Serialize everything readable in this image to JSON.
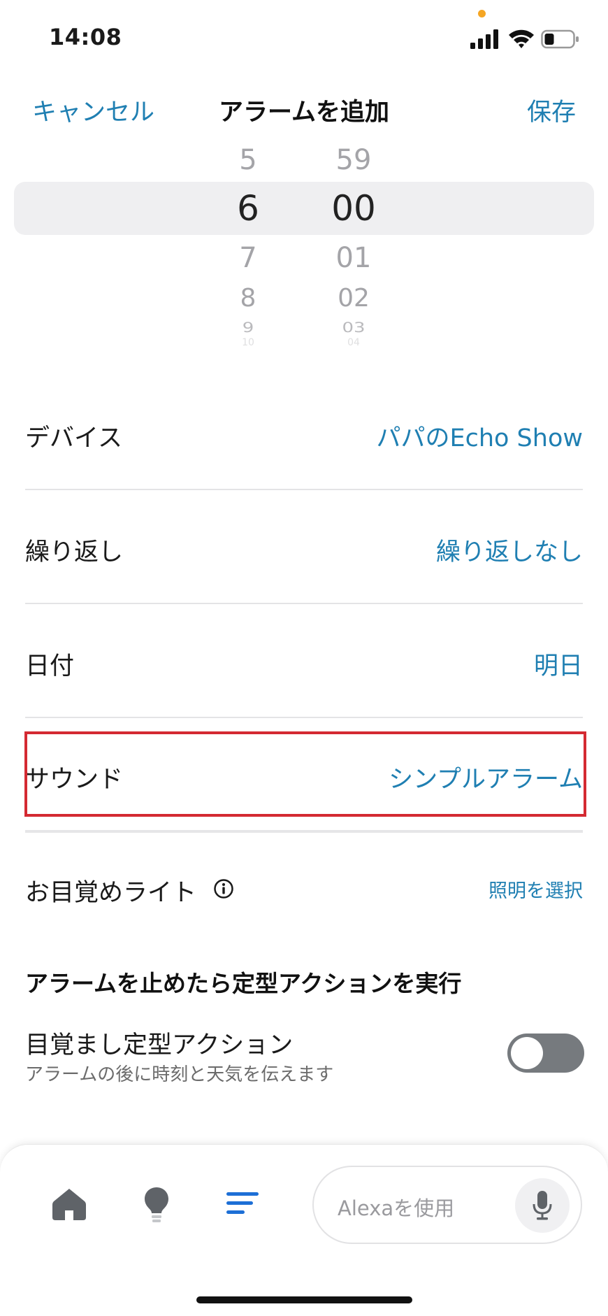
{
  "status_bar": {
    "time": "14:08"
  },
  "header": {
    "cancel_label": "キャンセル",
    "title": "アラームを追加",
    "save_label": "保存"
  },
  "time_picker": {
    "hours": {
      "above": "5",
      "selected": "6",
      "below1": "7",
      "below2": "8",
      "below3": "9",
      "below4": "10"
    },
    "minutes": {
      "above": "59",
      "selected": "00",
      "below1": "01",
      "below2": "02",
      "below3": "03",
      "below4": "04"
    }
  },
  "settings": {
    "device": {
      "label": "デバイス",
      "value": "パパのEcho Show"
    },
    "repeat": {
      "label": "繰り返し",
      "value": "繰り返しなし"
    },
    "date": {
      "label": "日付",
      "value": "明日"
    },
    "sound": {
      "label": "サウンド",
      "value": "シンプルアラーム"
    },
    "wake_light": {
      "label": "お目覚めライト",
      "value": "照明を選択"
    }
  },
  "routine_section": {
    "title": "アラームを止めたら定型アクションを実行",
    "routine": {
      "title": "目覚まし定型アクション",
      "subtitle": "アラームの後に時刻と天気を伝えます",
      "enabled": false
    }
  },
  "bottom_bar": {
    "alexa_placeholder": "Alexaを使用"
  },
  "colors": {
    "accent": "#1f7fb2",
    "highlight": "#d42a32",
    "toggle_off": "#767a7e",
    "tab_active": "#1d6fd6"
  }
}
